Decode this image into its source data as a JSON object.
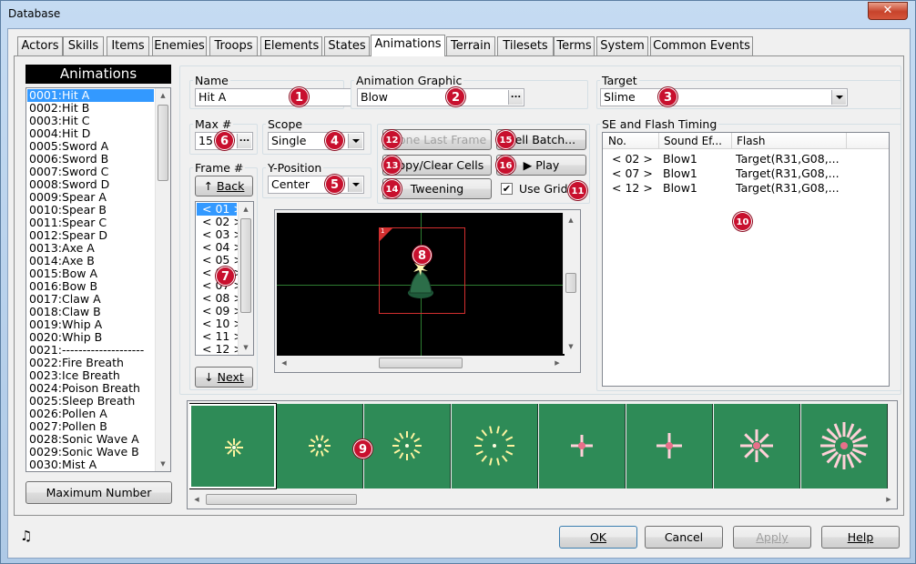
{
  "window": {
    "title": "Database",
    "close_label": "✕"
  },
  "tabs": [
    "Actors",
    "Skills",
    "Items",
    "Enemies",
    "Troops",
    "Elements",
    "States",
    "Animations",
    "Terrain",
    "Tilesets",
    "Terms",
    "System",
    "Common Events"
  ],
  "active_tab": "Animations",
  "list": {
    "header": "Animations",
    "items": [
      "0001:Hit A",
      "0002:Hit B",
      "0003:Hit C",
      "0004:Hit D",
      "0005:Sword A",
      "0006:Sword B",
      "0007:Sword C",
      "0008:Sword D",
      "0009:Spear A",
      "0010:Spear B",
      "0011:Spear C",
      "0012:Spear D",
      "0013:Axe A",
      "0014:Axe B",
      "0015:Bow A",
      "0016:Bow B",
      "0017:Claw A",
      "0018:Claw B",
      "0019:Whip A",
      "0020:Whip B",
      "0021:--------------------",
      "0022:Fire Breath",
      "0023:Ice Breath",
      "0024:Poison Breath",
      "0025:Sleep Breath",
      "0026:Pollen A",
      "0027:Pollen B",
      "0028:Sonic Wave A",
      "0029:Sonic Wave B",
      "0030:Mist A"
    ],
    "selected_index": 0,
    "max_button": "Maximum Number"
  },
  "name": {
    "label": "Name",
    "value": "Hit A"
  },
  "graphic": {
    "label": "Animation Graphic",
    "value": "Blow",
    "button": "..."
  },
  "target": {
    "label": "Target",
    "value": "Slime"
  },
  "max": {
    "label": "Max #",
    "value": "15",
    "button": "..."
  },
  "scope": {
    "label": "Scope",
    "value": "Single"
  },
  "ypos": {
    "label": "Y-Position",
    "value": "Center"
  },
  "frame": {
    "label": "Frame #",
    "back": "Back",
    "next": "Next",
    "back_icon": "↑",
    "next_icon": "↓",
    "items": [
      "< 01 >",
      "< 02 >",
      "< 03 >",
      "< 04 >",
      "< 05 >",
      "< 06 >",
      "< 07 >",
      "< 08 >",
      "< 09 >",
      "< 10 >",
      "< 11 >",
      "< 12 >"
    ],
    "selected_index": 0
  },
  "tools": {
    "one_last_frame": "Clone Last Frame",
    "copy_clear": "Copy/Clear Cells",
    "tweening": "Tweening",
    "cell_batch": "Cell Batch...",
    "play": "Play",
    "play_icon": "▶",
    "use_grid": "Use Grid",
    "use_grid_checked": "✔"
  },
  "se": {
    "label": "SE and Flash Timing",
    "columns": [
      "No.",
      "Sound Ef...",
      "Flash"
    ],
    "rows": [
      [
        "< 02 >",
        "Blow1",
        "Target(R31,G08,..."
      ],
      [
        "< 07 >",
        "Blow1",
        "Target(R31,G08,..."
      ],
      [
        "< 12 >",
        "Blow1",
        "Target(R31,G08,..."
      ]
    ]
  },
  "footer": {
    "ok": "OK",
    "cancel": "Cancel",
    "apply": "Apply",
    "help": "Help",
    "music_icon": "♫"
  },
  "cell_marker": "1",
  "badges": [
    "1",
    "2",
    "3",
    "4",
    "5",
    "6",
    "7",
    "8",
    "9",
    "10",
    "11",
    "12",
    "13",
    "14",
    "15",
    "16"
  ],
  "colors": {
    "selection": "#3399ff",
    "badge": "#c8102e",
    "frame_strip": "#2e8b57",
    "stage": "#000000",
    "grid": "#2e7d32",
    "cell_box": "#d32f2f"
  }
}
